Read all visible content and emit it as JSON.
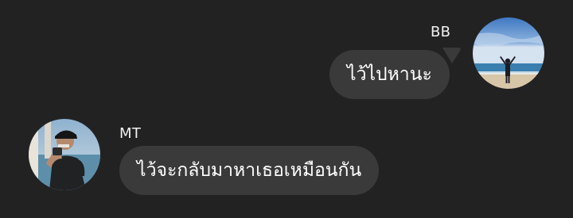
{
  "messages": [
    {
      "sender": "BB",
      "side": "right",
      "text": "ไว้ไปหานะ",
      "avatar_icon": "beach-person-photo"
    },
    {
      "sender": "MT",
      "side": "left",
      "text": "ไว้จะกลับมาหาเธอเหมือนกัน",
      "avatar_icon": "person-portrait-photo"
    }
  ],
  "colors": {
    "background": "#222223",
    "bubble": "#3a3a3b",
    "text": "#ffffff"
  }
}
